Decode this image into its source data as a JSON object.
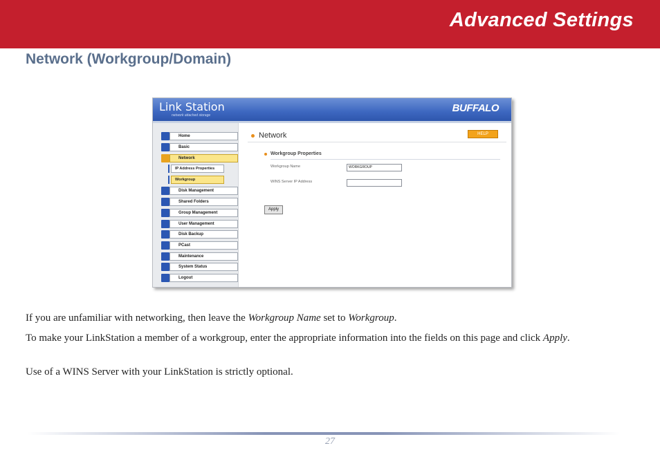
{
  "banner": {
    "title": "Advanced Settings",
    "color": "#c41f2d"
  },
  "section_heading": "Network (Workgroup/Domain)",
  "screenshot": {
    "logo": "Link Station",
    "logo_sub": "network attached storage",
    "brand": "BUFFALO",
    "nav": [
      {
        "label": "Home",
        "icon": "home-icon"
      },
      {
        "label": "Basic",
        "icon": "basic-icon"
      },
      {
        "label": "Network",
        "icon": "network-icon",
        "active": true
      },
      {
        "label": "Disk Management",
        "icon": "disk-icon"
      },
      {
        "label": "Shared Folders",
        "icon": "folder-icon"
      },
      {
        "label": "Group Management",
        "icon": "group-icon"
      },
      {
        "label": "User Management",
        "icon": "user-icon"
      },
      {
        "label": "Disk Backup",
        "icon": "backup-icon"
      },
      {
        "label": "PCast",
        "icon": "pcast-icon"
      },
      {
        "label": "Maintenance",
        "icon": "maintenance-icon"
      },
      {
        "label": "System Status",
        "icon": "status-icon"
      },
      {
        "label": "Logout",
        "icon": "logout-icon"
      }
    ],
    "subnav": [
      {
        "label": "IP Address Properties"
      },
      {
        "label": "Workgroup",
        "active": true
      }
    ],
    "content_title": "Network",
    "help_label": "HELP",
    "sub_title": "Workgroup Properties",
    "fields": {
      "workgroup_name_label": "Workgroup Name",
      "workgroup_name_value": "WORKGROUP",
      "wins_label": "WINS Server IP Address",
      "wins_value": ""
    },
    "apply_label": "Apply"
  },
  "paragraphs": {
    "p1_a": "If you are unfamiliar with networking, then leave the ",
    "p1_b": "Workgroup Name",
    "p1_c": " set to ",
    "p1_d": "Workgroup",
    "p1_e": ".",
    "p2_a": "To make your LinkStation a member of a workgroup, enter the appropriate information into the fields on this page and click ",
    "p2_b": "Apply",
    "p2_c": ".",
    "p3": "Use of a WINS Server with your LinkStation is strictly optional."
  },
  "page_number": "27"
}
